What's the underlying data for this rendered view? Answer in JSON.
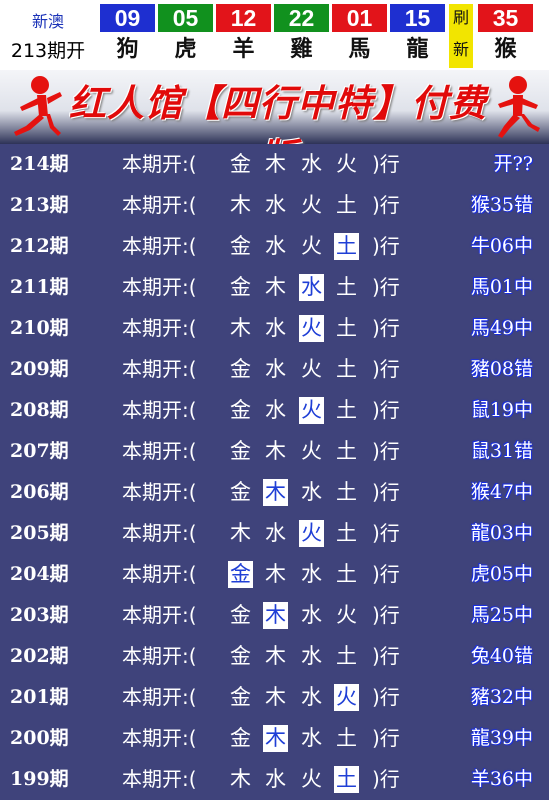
{
  "header": {
    "lottery_name": "新澳",
    "issue_label": "213期开",
    "balls": [
      {
        "num": "09",
        "zodiac": "狗",
        "color": "#1e2fd0"
      },
      {
        "num": "05",
        "zodiac": "虎",
        "color": "#11911e"
      },
      {
        "num": "12",
        "zodiac": "羊",
        "color": "#e2141a"
      },
      {
        "num": "22",
        "zodiac": "雞",
        "color": "#11911e"
      },
      {
        "num": "01",
        "zodiac": "馬",
        "color": "#e2141a"
      },
      {
        "num": "15",
        "zodiac": "龍",
        "color": "#1e2fd0"
      },
      {
        "num": "35",
        "zodiac": "猴",
        "color": "#e2141a"
      }
    ],
    "refresh_top": "刷",
    "refresh_bottom": "新"
  },
  "banner": {
    "title": "红人馆【四行中特】付费版"
  },
  "colors": {
    "table_bg": "#3f437b",
    "highlight_bg": "#ffffff",
    "highlight_text": "#1f3fd6",
    "result_glow": "#1a2fe0"
  },
  "rows": [
    {
      "period": "214期",
      "label": "本期开:(",
      "els": [
        "金",
        "木",
        "水",
        "火"
      ],
      "hl": -1,
      "close": ")行",
      "result": "开??"
    },
    {
      "period": "213期",
      "label": "本期开:(",
      "els": [
        "木",
        "水",
        "火",
        "土"
      ],
      "hl": -1,
      "close": ")行",
      "result": "猴35错"
    },
    {
      "period": "212期",
      "label": "本期开:(",
      "els": [
        "金",
        "水",
        "火",
        "土"
      ],
      "hl": 3,
      "close": ")行",
      "result": "牛06中"
    },
    {
      "period": "211期",
      "label": "本期开:(",
      "els": [
        "金",
        "木",
        "水",
        "土"
      ],
      "hl": 2,
      "close": ")行",
      "result": "馬01中"
    },
    {
      "period": "210期",
      "label": "本期开:(",
      "els": [
        "木",
        "水",
        "火",
        "土"
      ],
      "hl": 2,
      "close": ")行",
      "result": "馬49中"
    },
    {
      "period": "209期",
      "label": "本期开:(",
      "els": [
        "金",
        "水",
        "火",
        "土"
      ],
      "hl": -1,
      "close": ")行",
      "result": "豬08错"
    },
    {
      "period": "208期",
      "label": "本期开:(",
      "els": [
        "金",
        "水",
        "火",
        "土"
      ],
      "hl": 2,
      "close": ")行",
      "result": "鼠19中"
    },
    {
      "period": "207期",
      "label": "本期开:(",
      "els": [
        "金",
        "木",
        "火",
        "土"
      ],
      "hl": -1,
      "close": ")行",
      "result": "鼠31错"
    },
    {
      "period": "206期",
      "label": "本期开:(",
      "els": [
        "金",
        "木",
        "水",
        "土"
      ],
      "hl": 1,
      "close": ")行",
      "result": "猴47中"
    },
    {
      "period": "205期",
      "label": "本期开:(",
      "els": [
        "木",
        "水",
        "火",
        "土"
      ],
      "hl": 2,
      "close": ")行",
      "result": "龍03中"
    },
    {
      "period": "204期",
      "label": "本期开:(",
      "els": [
        "金",
        "木",
        "水",
        "土"
      ],
      "hl": 0,
      "close": ")行",
      "result": "虎05中"
    },
    {
      "period": "203期",
      "label": "本期开:(",
      "els": [
        "金",
        "木",
        "水",
        "火"
      ],
      "hl": 1,
      "close": ")行",
      "result": "馬25中"
    },
    {
      "period": "202期",
      "label": "本期开:(",
      "els": [
        "金",
        "木",
        "水",
        "土"
      ],
      "hl": -1,
      "close": ")行",
      "result": "兔40错"
    },
    {
      "period": "201期",
      "label": "本期开:(",
      "els": [
        "金",
        "木",
        "水",
        "火"
      ],
      "hl": 3,
      "close": ")行",
      "result": "豬32中"
    },
    {
      "period": "200期",
      "label": "本期开:(",
      "els": [
        "金",
        "木",
        "水",
        "土"
      ],
      "hl": 1,
      "close": ")行",
      "result": "龍39中"
    },
    {
      "period": "199期",
      "label": "本期开:(",
      "els": [
        "木",
        "水",
        "火",
        "土"
      ],
      "hl": 3,
      "close": ")行",
      "result": "羊36中"
    }
  ]
}
